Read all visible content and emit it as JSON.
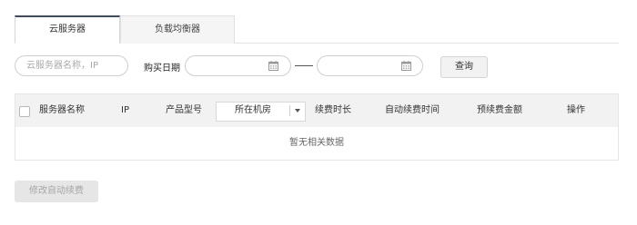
{
  "tabs": [
    {
      "label": "云服务器",
      "active": true
    },
    {
      "label": "负载均衡器",
      "active": false
    }
  ],
  "filters": {
    "search_placeholder": "云服务器名称，IP",
    "search_value": "",
    "date_label": "购买日期",
    "date_start": "",
    "date_end": "",
    "query_label": "查询"
  },
  "table": {
    "headers": {
      "name": "服务器名称",
      "ip": "IP",
      "model": "产品型号",
      "room": "所在机房",
      "duration": "续费时长",
      "auto_time": "自动续费时间",
      "amount": "预续费金额",
      "action": "操作"
    },
    "empty_text": "暂无相关数据"
  },
  "footer": {
    "modify_label": "修改自动续费"
  },
  "icons": {
    "calendar": "calendar-icon",
    "dropdown": "chevron-down-icon",
    "checkbox": "checkbox"
  }
}
